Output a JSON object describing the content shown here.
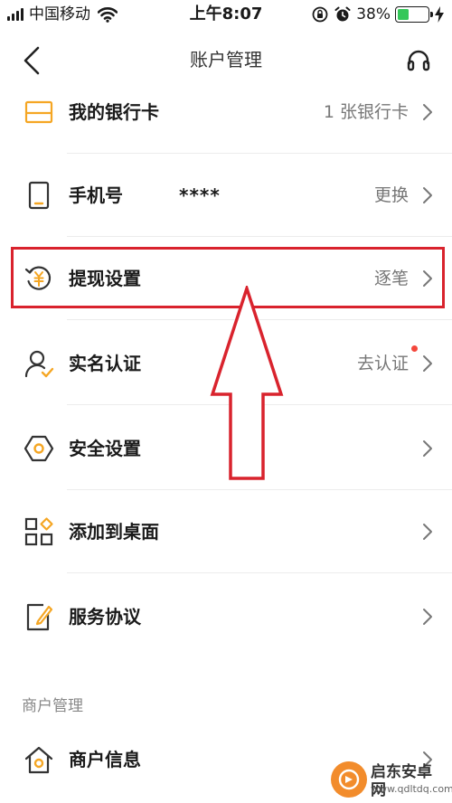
{
  "status_bar": {
    "carrier": "中国移动",
    "time": "上午8:07",
    "battery_percent": "38%",
    "battery_level": 0.38,
    "battery_color": "#34c759"
  },
  "nav": {
    "title": "账户管理",
    "back_icon": "chevron-left-icon",
    "support_icon": "headset-icon"
  },
  "accent_color": "#f5a623",
  "highlight_color": "#d9232d",
  "items": [
    {
      "label": "我的银行卡",
      "value": "1 张银行卡",
      "icon": "bank-card-icon"
    },
    {
      "label": "手机号",
      "masked": "****",
      "value": "更换",
      "icon": "phone-icon"
    },
    {
      "label": "提现设置",
      "value": "逐笔",
      "icon": "withdraw-yuan-icon"
    },
    {
      "label": "实名认证",
      "value": "去认证",
      "icon": "user-verified-icon",
      "badge_dot": true
    },
    {
      "label": "安全设置",
      "value": "",
      "icon": "security-hexagon-icon"
    },
    {
      "label": "添加到桌面",
      "value": "",
      "icon": "app-grid-icon"
    },
    {
      "label": "服务协议",
      "value": "",
      "icon": "agreement-edit-icon"
    }
  ],
  "merchant_section": {
    "header": "商户管理",
    "items": [
      {
        "label": "商户信息",
        "value": "",
        "icon": "store-home-icon"
      }
    ]
  },
  "watermark": {
    "title": "启东安卓网",
    "url": "www.qdltdq.com"
  }
}
